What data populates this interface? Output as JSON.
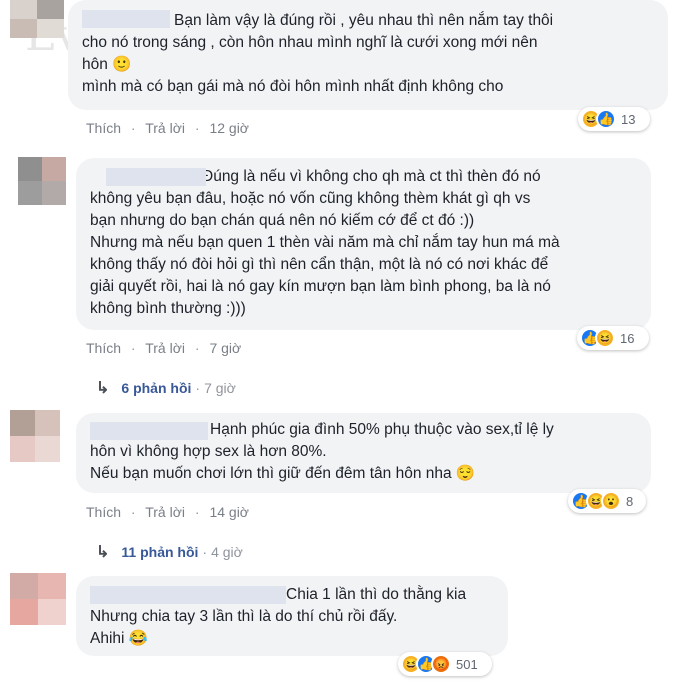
{
  "watermark": "Eva.vn",
  "comments": [
    {
      "text": "Bạn làm vậy là đúng rồi , yêu nhau thì nên nắm tay thôi\ncho nó trong sáng , còn hôn nhau mình nghĩ là cưới xong mới nên\nhôn 🙂\nmình mà có bạn gái mà nó đòi hôn mình nhất định không cho",
      "like": "Thích",
      "reply": "Trả lời",
      "time": "12 giờ",
      "reaction_count": "13"
    },
    {
      "text": "Đúng là nếu vì không cho qh mà ct thì thèn đó nó\nkhông yêu bạn đâu, hoặc nó vốn cũng không thèm khát gì qh vs\nbạn nhưng do bạn chán quá nên nó kiếm cớ để ct đó :))\nNhưng mà nếu bạn quen 1 thèn vài năm mà chỉ nắm tay hun má mà\nkhông thấy nó đòi hỏi gì thì nên cẩn thận, một là nó có nơi khác để\ngiải quyết rồi, hai là nó gay kín mượn bạn làm bình phong, ba là nó\nkhông bình thường :)))",
      "like": "Thích",
      "reply": "Trả lời",
      "time": "7 giờ",
      "reaction_count": "16",
      "replies_label": "6 phản hồi",
      "replies_time": "7 giờ"
    },
    {
      "text": "Hạnh phúc gia đình 50% phụ thuộc vào sex,tỉ lệ ly\nhôn vì không hợp sex là hơn 80%.\nNếu bạn muốn chơi lớn thì giữ đến đêm tân hôn nha 😌",
      "like": "Thích",
      "reply": "Trả lời",
      "time": "14 giờ",
      "reaction_count": "8",
      "replies_label": "11 phản hồi",
      "replies_time": "4 giờ"
    },
    {
      "text": "Chia 1 lần thì do thằng kia\nNhưng chia tay 3 lần thì là do thí chủ rồi đấy.\nAhihi 😂",
      "reaction_count": "501"
    }
  ],
  "colors": {
    "bubble": "#f2f3f5",
    "link": "#385898",
    "muted": "#7a7f87",
    "like_blue": "#1877f2",
    "haha_yellow": "#f7b125"
  }
}
